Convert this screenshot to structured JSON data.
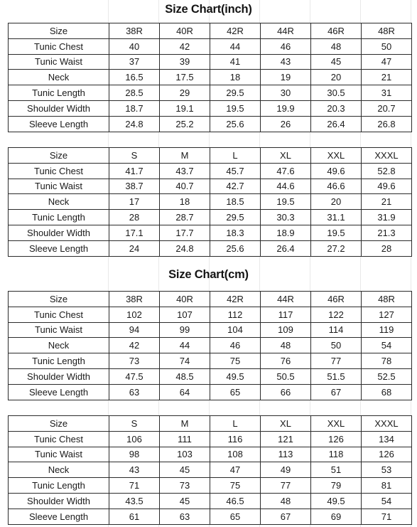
{
  "page": {
    "background_color": "#ffffff",
    "text_color": "#1a1a1a",
    "border_color": "#2b2b2b"
  },
  "titles": {
    "inch": "Size Chart(inch)",
    "cm": "Size Chart(cm)"
  },
  "chart_data": {
    "type": "table",
    "title": "Size Chart(inch) / Size Chart(cm)",
    "tables": [
      {
        "id": "inch-numeric",
        "unit": "inch",
        "title": "Size Chart(inch)",
        "row_header_label": "Size",
        "categories": [
          "38R",
          "40R",
          "42R",
          "44R",
          "46R",
          "48R"
        ],
        "measurements": [
          "Tunic Chest",
          "Tunic Waist",
          "Neck",
          "Tunic Length",
          "Shoulder Width",
          "Sleeve Length"
        ],
        "rows": [
          {
            "label": "Size",
            "values": [
              "38R",
              "40R",
              "42R",
              "44R",
              "46R",
              "48R"
            ]
          },
          {
            "label": "Tunic Chest",
            "values": [
              "40",
              "42",
              "44",
              "46",
              "48",
              "50"
            ]
          },
          {
            "label": "Tunic Waist",
            "values": [
              "37",
              "39",
              "41",
              "43",
              "45",
              "47"
            ]
          },
          {
            "label": "Neck",
            "values": [
              "16.5",
              "17.5",
              "18",
              "19",
              "20",
              "21"
            ]
          },
          {
            "label": "Tunic Length",
            "values": [
              "28.5",
              "29",
              "29.5",
              "30",
              "30.5",
              "31"
            ]
          },
          {
            "label": "Shoulder Width",
            "values": [
              "18.7",
              "19.1",
              "19.5",
              "19.9",
              "20.3",
              "20.7"
            ]
          },
          {
            "label": "Sleeve Length",
            "values": [
              "24.8",
              "25.2",
              "25.6",
              "26",
              "26.4",
              "26.8"
            ]
          }
        ]
      },
      {
        "id": "inch-letter",
        "unit": "inch",
        "title": "Size Chart(inch)",
        "row_header_label": "Size",
        "categories": [
          "S",
          "M",
          "L",
          "XL",
          "XXL",
          "XXXL"
        ],
        "measurements": [
          "Tunic Chest",
          "Tunic Waist",
          "Neck",
          "Tunic Length",
          "Shoulder Width",
          "Sleeve Length"
        ],
        "rows": [
          {
            "label": "Size",
            "values": [
              "S",
              "M",
              "L",
              "XL",
              "XXL",
              "XXXL"
            ]
          },
          {
            "label": "Tunic Chest",
            "values": [
              "41.7",
              "43.7",
              "45.7",
              "47.6",
              "49.6",
              "52.8"
            ]
          },
          {
            "label": "Tunic Waist",
            "values": [
              "38.7",
              "40.7",
              "42.7",
              "44.6",
              "46.6",
              "49.6"
            ]
          },
          {
            "label": "Neck",
            "values": [
              "17",
              "18",
              "18.5",
              "19.5",
              "20",
              "21"
            ]
          },
          {
            "label": "Tunic Length",
            "values": [
              "28",
              "28.7",
              "29.5",
              "30.3",
              "31.1",
              "31.9"
            ]
          },
          {
            "label": "Shoulder Width",
            "values": [
              "17.1",
              "17.7",
              "18.3",
              "18.9",
              "19.5",
              "21.3"
            ]
          },
          {
            "label": "Sleeve Length",
            "values": [
              "24",
              "24.8",
              "25.6",
              "26.4",
              "27.2",
              "28"
            ]
          }
        ]
      },
      {
        "id": "cm-numeric",
        "unit": "cm",
        "title": "Size Chart(cm)",
        "row_header_label": "Size",
        "categories": [
          "38R",
          "40R",
          "42R",
          "44R",
          "46R",
          "48R"
        ],
        "measurements": [
          "Tunic Chest",
          "Tunic Waist",
          "Neck",
          "Tunic Length",
          "Shoulder Width",
          "Sleeve Length"
        ],
        "rows": [
          {
            "label": "Size",
            "values": [
              "38R",
              "40R",
              "42R",
              "44R",
              "46R",
              "48R"
            ]
          },
          {
            "label": "Tunic Chest",
            "values": [
              "102",
              "107",
              "112",
              "117",
              "122",
              "127"
            ]
          },
          {
            "label": "Tunic Waist",
            "values": [
              "94",
              "99",
              "104",
              "109",
              "114",
              "119"
            ]
          },
          {
            "label": "Neck",
            "values": [
              "42",
              "44",
              "46",
              "48",
              "50",
              "54"
            ]
          },
          {
            "label": "Tunic Length",
            "values": [
              "73",
              "74",
              "75",
              "76",
              "77",
              "78"
            ]
          },
          {
            "label": "Shoulder Width",
            "values": [
              "47.5",
              "48.5",
              "49.5",
              "50.5",
              "51.5",
              "52.5"
            ]
          },
          {
            "label": "Sleeve Length",
            "values": [
              "63",
              "64",
              "65",
              "66",
              "67",
              "68"
            ]
          }
        ]
      },
      {
        "id": "cm-letter",
        "unit": "cm",
        "title": "Size Chart(cm)",
        "row_header_label": "Size",
        "categories": [
          "S",
          "M",
          "L",
          "XL",
          "XXL",
          "XXXL"
        ],
        "measurements": [
          "Tunic Chest",
          "Tunic Waist",
          "Neck",
          "Tunic Length",
          "Shoulder Width",
          "Sleeve Length"
        ],
        "rows": [
          {
            "label": "Size",
            "values": [
              "S",
              "M",
              "L",
              "XL",
              "XXL",
              "XXXL"
            ]
          },
          {
            "label": "Tunic Chest",
            "values": [
              "106",
              "111",
              "116",
              "121",
              "126",
              "134"
            ]
          },
          {
            "label": "Tunic Waist",
            "values": [
              "98",
              "103",
              "108",
              "113",
              "118",
              "126"
            ]
          },
          {
            "label": "Neck",
            "values": [
              "43",
              "45",
              "47",
              "49",
              "51",
              "53"
            ]
          },
          {
            "label": "Tunic Length",
            "values": [
              "71",
              "73",
              "75",
              "77",
              "79",
              "81"
            ]
          },
          {
            "label": "Shoulder Width",
            "values": [
              "43.5",
              "45",
              "46.5",
              "48",
              "49.5",
              "54"
            ]
          },
          {
            "label": "Sleeve Length",
            "values": [
              "61",
              "63",
              "65",
              "67",
              "69",
              "71"
            ]
          }
        ]
      }
    ]
  }
}
